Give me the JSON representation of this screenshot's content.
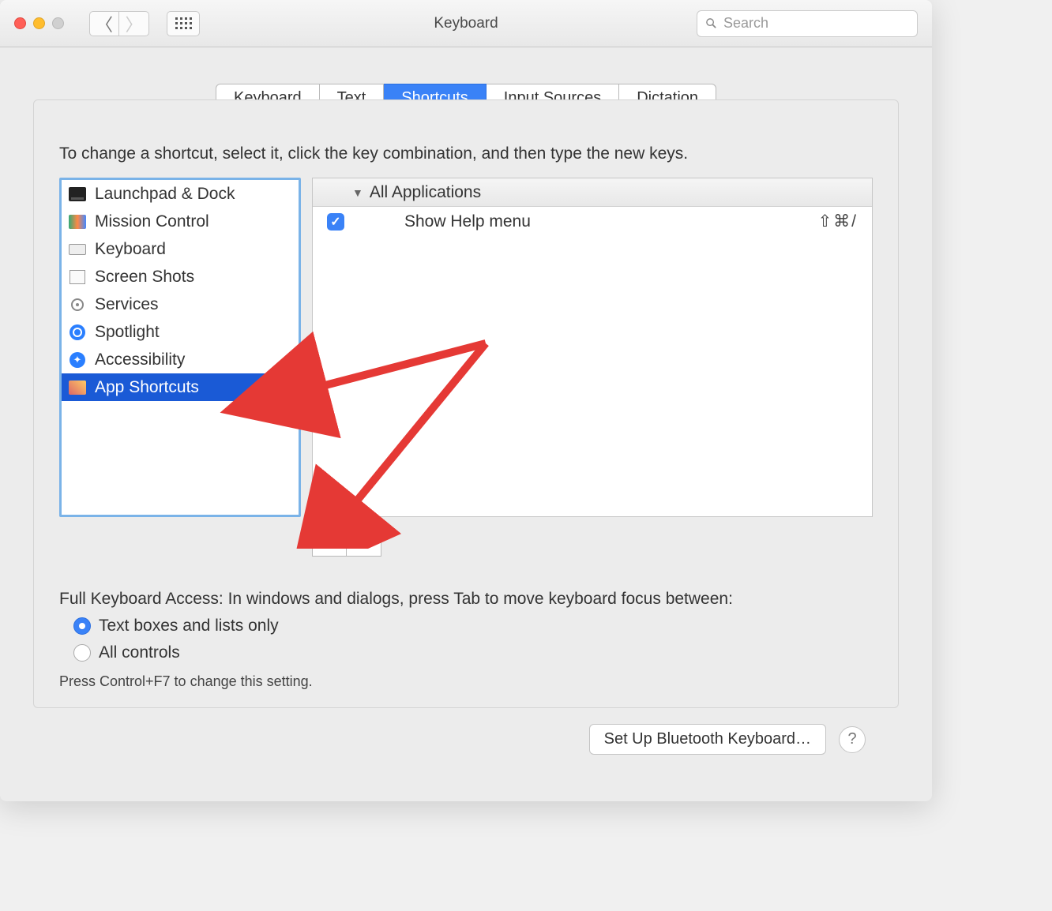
{
  "window": {
    "title": "Keyboard"
  },
  "search": {
    "placeholder": "Search"
  },
  "tabs": [
    {
      "label": "Keyboard",
      "active": false
    },
    {
      "label": "Text",
      "active": false
    },
    {
      "label": "Shortcuts",
      "active": true
    },
    {
      "label": "Input Sources",
      "active": false
    },
    {
      "label": "Dictation",
      "active": false
    }
  ],
  "instruction": "To change a shortcut, select it, click the key combination, and then type the new keys.",
  "categories": [
    {
      "label": "Launchpad & Dock",
      "icon": "launchpad-icon"
    },
    {
      "label": "Mission Control",
      "icon": "mission-control-icon"
    },
    {
      "label": "Keyboard",
      "icon": "keyboard-icon"
    },
    {
      "label": "Screen Shots",
      "icon": "screenshot-icon"
    },
    {
      "label": "Services",
      "icon": "gear-icon"
    },
    {
      "label": "Spotlight",
      "icon": "spotlight-icon"
    },
    {
      "label": "Accessibility",
      "icon": "accessibility-icon"
    },
    {
      "label": "App Shortcuts",
      "icon": "app-icon",
      "selected": true
    }
  ],
  "shortcuts": {
    "group_header": "All Applications",
    "items": [
      {
        "enabled": true,
        "label": "Show Help menu",
        "keys": "⇧⌘/"
      }
    ]
  },
  "buttons": {
    "add": "+",
    "remove": "–"
  },
  "full_keyboard_access": {
    "heading": "Full Keyboard Access: In windows and dialogs, press Tab to move keyboard focus between:",
    "options": [
      {
        "label": "Text boxes and lists only",
        "selected": true
      },
      {
        "label": "All controls",
        "selected": false
      }
    ],
    "hint": "Press Control+F7 to change this setting."
  },
  "footer": {
    "bluetooth_button": "Set Up Bluetooth Keyboard…",
    "help": "?"
  }
}
